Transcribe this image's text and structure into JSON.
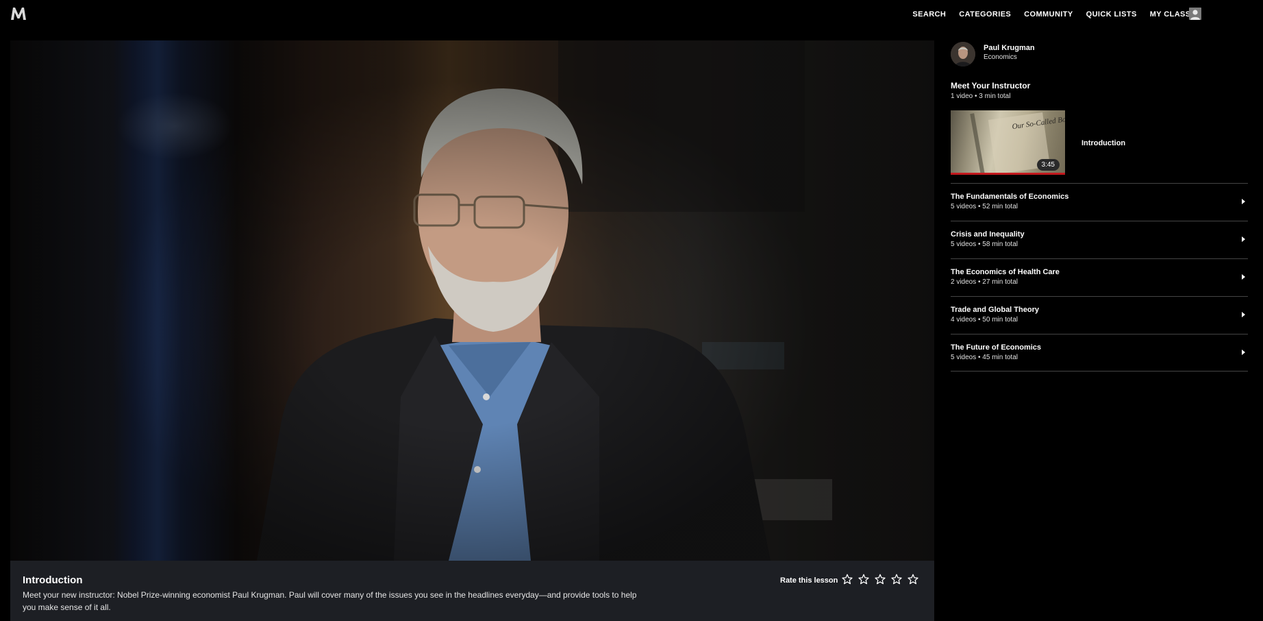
{
  "colors": {
    "background": "#000000",
    "info_panel": "#1d1f24",
    "progress_accent": "#c2181d",
    "divider": "#444444"
  },
  "header": {
    "logo_icon": "m-logo-icon",
    "nav": [
      "SEARCH",
      "CATEGORIES",
      "COMMUNITY",
      "QUICK LISTS",
      "MY CLASSES"
    ],
    "account_icon": "user-avatar-icon"
  },
  "lesson": {
    "title": "Introduction",
    "description": "Meet your new instructor: Nobel Prize-winning economist Paul Krugman. Paul will cover many of the issues you see in the headlines everyday—and provide tools to help you make sense of it all.",
    "rate_label": "Rate this lesson",
    "rating_stars": 5,
    "rating_value": 0
  },
  "sidebar": {
    "instructor": {
      "name": "Paul Krugman",
      "subject": "Economics"
    },
    "current_chapter": {
      "title": "Meet Your Instructor",
      "meta": "1 video • 3 min total",
      "lessons": [
        {
          "label": "Introduction",
          "duration": "3:45",
          "thumb_text": "Our So-Called Boom"
        }
      ]
    },
    "chapters": [
      {
        "title": "The Fundamentals of Economics",
        "meta": "5 videos • 52 min total"
      },
      {
        "title": "Crisis and Inequality",
        "meta": "5 videos • 58 min total"
      },
      {
        "title": "The Economics of Health Care",
        "meta": "2 videos • 27 min total"
      },
      {
        "title": "Trade and Global Theory",
        "meta": "4 videos • 50 min total"
      },
      {
        "title": "The Future of Economics",
        "meta": "5 videos • 45 min total"
      }
    ]
  }
}
